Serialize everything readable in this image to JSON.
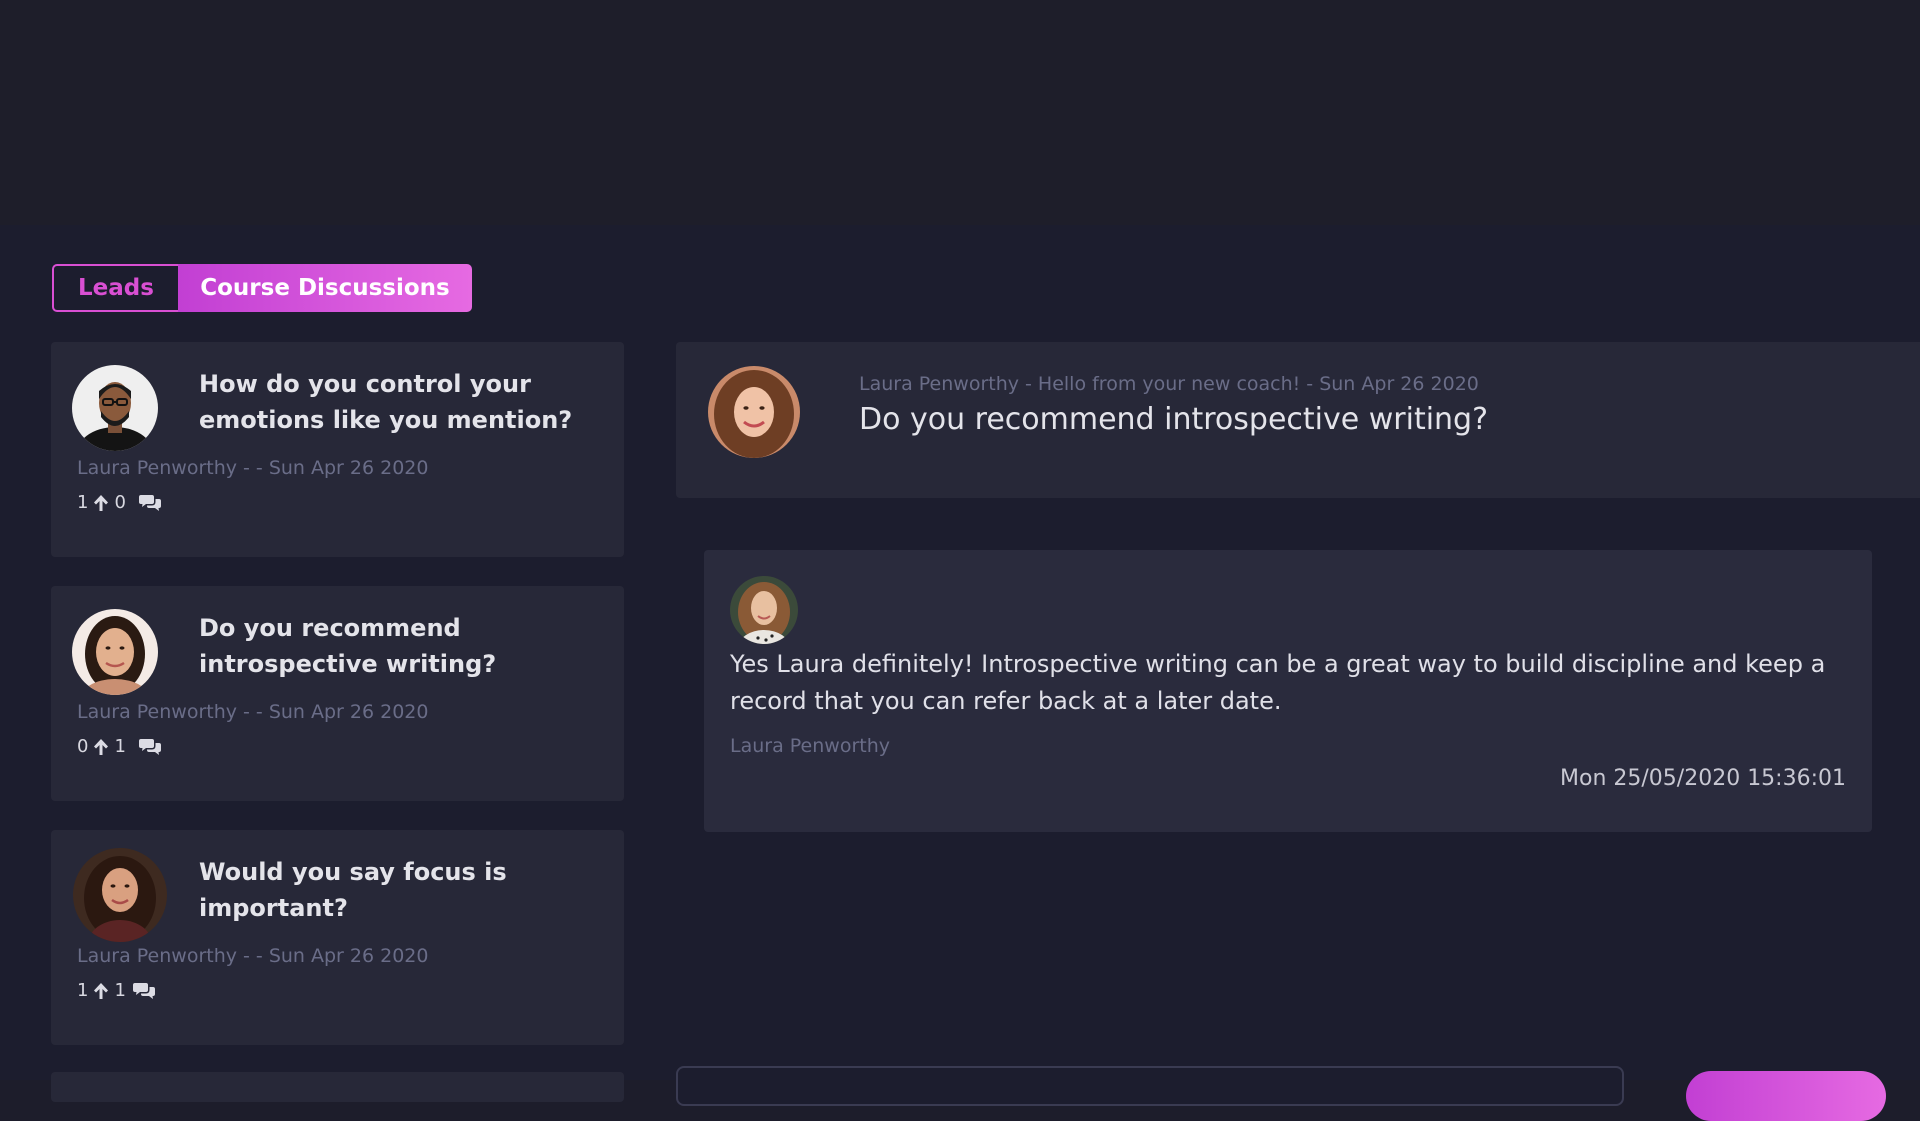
{
  "tabs": {
    "leads": "Leads",
    "course_discussions": "Course Discussions"
  },
  "discussions": [
    {
      "title": "How do you control your emotions like you mention?",
      "meta": "Laura Penworthy - - Sun Apr 26 2020",
      "upvotes": "1",
      "replies": "0"
    },
    {
      "title": "Do you recommend introspective writing?",
      "meta": "Laura Penworthy - - Sun Apr 26 2020",
      "upvotes": "0",
      "replies": "1"
    },
    {
      "title": "Would you say focus is important?",
      "meta": "Laura Penworthy - - Sun Apr 26 2020",
      "upvotes": "1",
      "replies": "1"
    }
  ],
  "question": {
    "meta": "Laura Penworthy - Hello from your new coach! - Sun Apr 26 2020",
    "title": "Do you recommend introspective writing?"
  },
  "answer": {
    "body": "Yes Laura definitely! Introspective writing can be a great way to build discipline and keep a record that you can refer back at a later date.",
    "author": "Laura Penworthy",
    "timestamp": "Mon 25/05/2020 15:36:01"
  },
  "colors": {
    "accent": "#d94fd3",
    "panel": "#272838",
    "background": "#1c1d2e"
  }
}
